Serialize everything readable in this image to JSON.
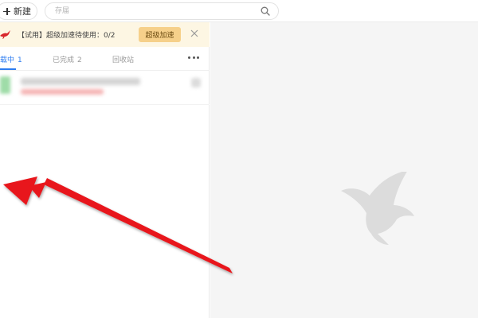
{
  "toolbar": {
    "new_label": "新建",
    "search_placeholder": "存届",
    "search_value": ""
  },
  "banner": {
    "text": "【试用】超级加速待使用：0/2",
    "boost_label": "超级加速",
    "close_symbol": "×"
  },
  "tabs": [
    {
      "label": "载中",
      "count": "1",
      "active": true
    },
    {
      "label": "已完成",
      "count": "2",
      "active": false
    },
    {
      "label": "回收站",
      "count": "",
      "active": false
    }
  ],
  "tasks": [
    {
      "name": "",
      "status": ""
    }
  ],
  "icons": {
    "new": "plus-icon",
    "search": "search-icon",
    "banner": "bird-icon",
    "close": "close-icon",
    "more": "more-icon",
    "watermark": "hummingbird-icon"
  },
  "colors": {
    "accent": "#2d7cf0",
    "banner_bg": "#fdf6e3",
    "boost_button": "#f6d08a",
    "annotation_arrow": "#e8141a",
    "right_panel_bg": "#f5f5f5"
  }
}
